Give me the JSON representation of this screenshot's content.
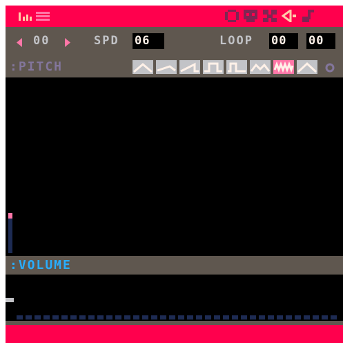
{
  "header": {
    "left_tabs": [
      "music-bars-icon",
      "grid-icon"
    ],
    "right_tabs": [
      "code-icon",
      "sprite-icon",
      "map-icon",
      "sfx-icon",
      "music-note-icon"
    ]
  },
  "controls": {
    "prev_icon": "left-arrow",
    "sfx_index": "00",
    "next_icon": "right-arrow",
    "speed_label": "SPD",
    "speed_value": "06",
    "loop_label": "LOOP",
    "loop_start": "00",
    "loop_end": "00"
  },
  "pitch": {
    "label": ":PITCH",
    "waveforms": [
      "triangle",
      "tilted-saw",
      "saw",
      "square",
      "pulse",
      "organ",
      "noise",
      "phaser"
    ],
    "selected_waveform": "noise",
    "extra_icon": "custom-instrument-circle-icon"
  },
  "volume": {
    "label": ":VOLUME"
  },
  "colors": {
    "red": "#ff004d",
    "dark_grey": "#5f574f",
    "light_grey": "#c2c3c7",
    "pink": "#ff77a8",
    "blue": "#29adff",
    "dark_blue": "#1d2b53",
    "lavender": "#83769c",
    "peach": "#ffccaa",
    "white": "#fff1e8"
  }
}
